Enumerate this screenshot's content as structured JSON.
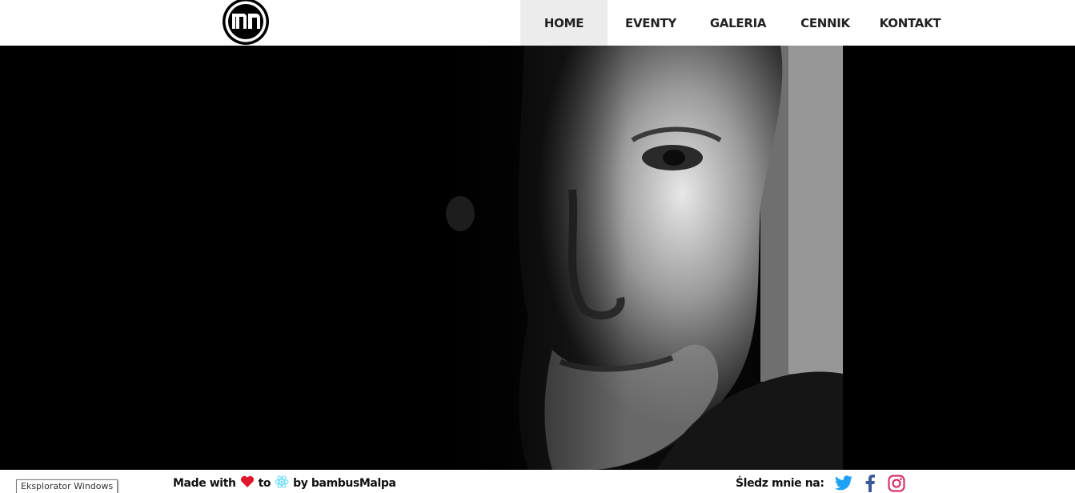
{
  "header": {
    "logo_text": "mp",
    "nav": [
      {
        "label": "HOME",
        "active": true
      },
      {
        "label": "EVENTY",
        "active": false
      },
      {
        "label": "GALERIA",
        "active": false
      },
      {
        "label": "CENNIK",
        "active": false
      },
      {
        "label": "KONTAKT",
        "active": false
      }
    ]
  },
  "hero": {
    "alt": "portrait photo"
  },
  "footer": {
    "made_prefix": "Made with",
    "made_to": "to",
    "made_suffix": "by bambusMalpa",
    "follow_label": "Śledz mnie na:",
    "social_icons": [
      "twitter-icon",
      "facebook-icon",
      "instagram-icon"
    ]
  },
  "tooltip": {
    "text": "Eksplorator Windows"
  },
  "colors": {
    "heart": "#e0162b",
    "react": "#61dafb",
    "twitter": "#1da1f2",
    "facebook": "#3b5998",
    "instagram": "#d6336c"
  }
}
